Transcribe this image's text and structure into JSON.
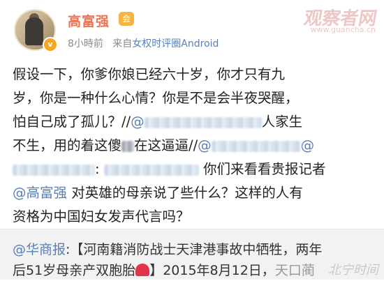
{
  "header": {
    "user_name": "高富强",
    "time": "8小時前",
    "source_prefix": "来自",
    "source": "女权时评圈Android",
    "verified_badge": "v",
    "member_icon": "会"
  },
  "watermark": {
    "main": "观察者网",
    "sub": "www.guancha.cn",
    "bottom": "北宁时间"
  },
  "post": {
    "line1": "假设一下，你爹你娘已经六十岁，你才只有九",
    "line2": "岁，你是一种什么心情？你是不是会半夜哭醒，",
    "line3a": "怕自己成了孤儿？//",
    "line3_mention": "@",
    "line3b": "人家生",
    "line4a": "不生，用的着这傻",
    "line4b": "在这逼逼//",
    "line4_mention": "@",
    "line4_end": "@",
    "line5_colon": ":",
    "line5b": "你们来看看贵报记者",
    "line6_mention": "@高富强",
    "line6b": " 对英雄的母亲说了些什么？这样的人有",
    "line7": "资格为中国妇女发声代言吗？"
  },
  "repost": {
    "mention": "@华商报",
    "line1b": ":【河南籍消防战士天津港事故中牺牲，两年",
    "line2a": "后51岁母亲产双胞胎",
    "line2b": "】2015年8月12日，",
    "line2c": "天口蔺"
  }
}
